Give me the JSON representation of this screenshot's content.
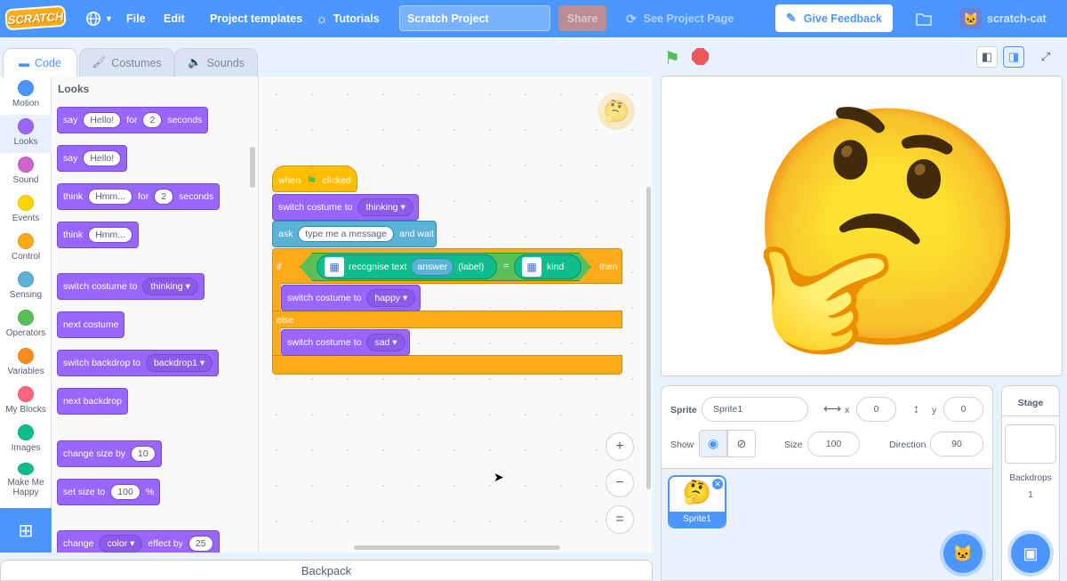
{
  "menubar": {
    "logo": "SCRATCH",
    "file": "File",
    "edit": "Edit",
    "templates": "Project templates",
    "tutorials": "Tutorials",
    "project_title": "Scratch Project",
    "share": "Share",
    "see_project": "See Project Page",
    "feedback": "Give Feedback",
    "username": "scratch-cat"
  },
  "tabs": {
    "code": "Code",
    "costumes": "Costumes",
    "sounds": "Sounds"
  },
  "categories": [
    {
      "label": "Motion",
      "color": "#4c97ff"
    },
    {
      "label": "Looks",
      "color": "#9966ff"
    },
    {
      "label": "Sound",
      "color": "#cf63cf"
    },
    {
      "label": "Events",
      "color": "#ffd500"
    },
    {
      "label": "Control",
      "color": "#ffab19"
    },
    {
      "label": "Sensing",
      "color": "#5cb1d6"
    },
    {
      "label": "Operators",
      "color": "#59c059"
    },
    {
      "label": "Variables",
      "color": "#ff8c1a"
    },
    {
      "label": "My Blocks",
      "color": "#ff6680"
    },
    {
      "label": "Images",
      "color": "#0fbd8c"
    },
    {
      "label": "Make Me Happy",
      "color": "#0fbd8c"
    }
  ],
  "palette": {
    "title": "Looks",
    "say_for": {
      "say": "say",
      "text": "Hello!",
      "for": "for",
      "secs": "2",
      "seconds": "seconds"
    },
    "say": {
      "say": "say",
      "text": "Hello!"
    },
    "think_for": {
      "think": "think",
      "text": "Hmm...",
      "for": "for",
      "secs": "2",
      "seconds": "seconds"
    },
    "think": {
      "think": "think",
      "text": "Hmm..."
    },
    "switch_costume": {
      "label": "switch costume to",
      "value": "thinking"
    },
    "next_costume": "next costume",
    "switch_backdrop": {
      "label": "switch backdrop to",
      "value": "backdrop1"
    },
    "next_backdrop": "next backdrop",
    "change_size": {
      "label": "change size by",
      "value": "10"
    },
    "set_size": {
      "label": "set size to",
      "value": "100",
      "unit": "%"
    },
    "change_effect": {
      "change": "change",
      "effect_name": "color",
      "by": "effect by",
      "value": "25"
    }
  },
  "script": {
    "when": "when",
    "clicked": "clicked",
    "switch1_label": "switch costume to",
    "switch1_value": "thinking",
    "ask": "ask",
    "ask_text": "type me a message",
    "and_wait": "and wait",
    "if": "if",
    "recognise": "recognise text",
    "answer": "answer",
    "label": "(label)",
    "equals": "=",
    "kind": "kind",
    "then": "then",
    "switch2_label": "switch costume to",
    "switch2_value": "happy",
    "else": "else",
    "switch3_label": "switch costume to",
    "switch3_value": "sad"
  },
  "zoom": {
    "in": "+",
    "out": "−",
    "reset": "="
  },
  "backpack": "Backpack",
  "sprite": {
    "sprite_label": "Sprite",
    "name": "Sprite1",
    "x_label": "x",
    "x": "0",
    "y_label": "y",
    "y": "0",
    "show_label": "Show",
    "size_label": "Size",
    "size": "100",
    "direction_label": "Direction",
    "direction": "90",
    "tile_name": "Sprite1"
  },
  "stage_panel": {
    "title": "Stage",
    "backdrops_label": "Backdrops",
    "backdrops_count": "1"
  },
  "stage_emoji": "🤔",
  "ws_emoji": "🤔",
  "tile_emoji": "🤔"
}
